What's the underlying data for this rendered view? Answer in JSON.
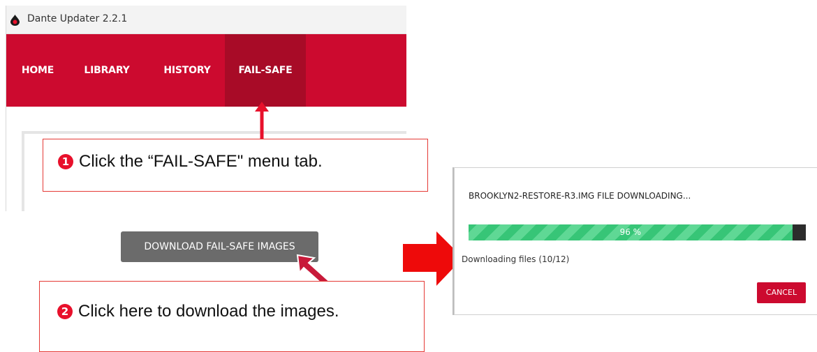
{
  "window": {
    "title": "Dante Updater 2.2.1",
    "logo": "dante-logo"
  },
  "nav": {
    "tabs": [
      {
        "label": "HOME"
      },
      {
        "label": "LIBRARY"
      },
      {
        "label": "HISTORY"
      },
      {
        "label": "FAIL-SAFE",
        "active": true
      }
    ]
  },
  "callouts": {
    "step1": {
      "number": "❶",
      "text": "Click the “FAIL-SAFE\" menu tab."
    },
    "step2": {
      "number": "❷",
      "text": "Click here to download the images."
    }
  },
  "download_button": {
    "label": "DOWNLOAD FAIL-SAFE IMAGES"
  },
  "dialog": {
    "title": "BROOKLYN2-RESTORE-R3.IMG FILE DOWNLOADING...",
    "progress": 96,
    "progress_label": "96 %",
    "status": "Downloading files (10/12)",
    "cancel_label": "CANCEL"
  },
  "colors": {
    "brand_red": "#cc0a2f",
    "active_tab": "#a80b27",
    "progress_green": "#37c577",
    "annotation_red": "#e53935"
  }
}
